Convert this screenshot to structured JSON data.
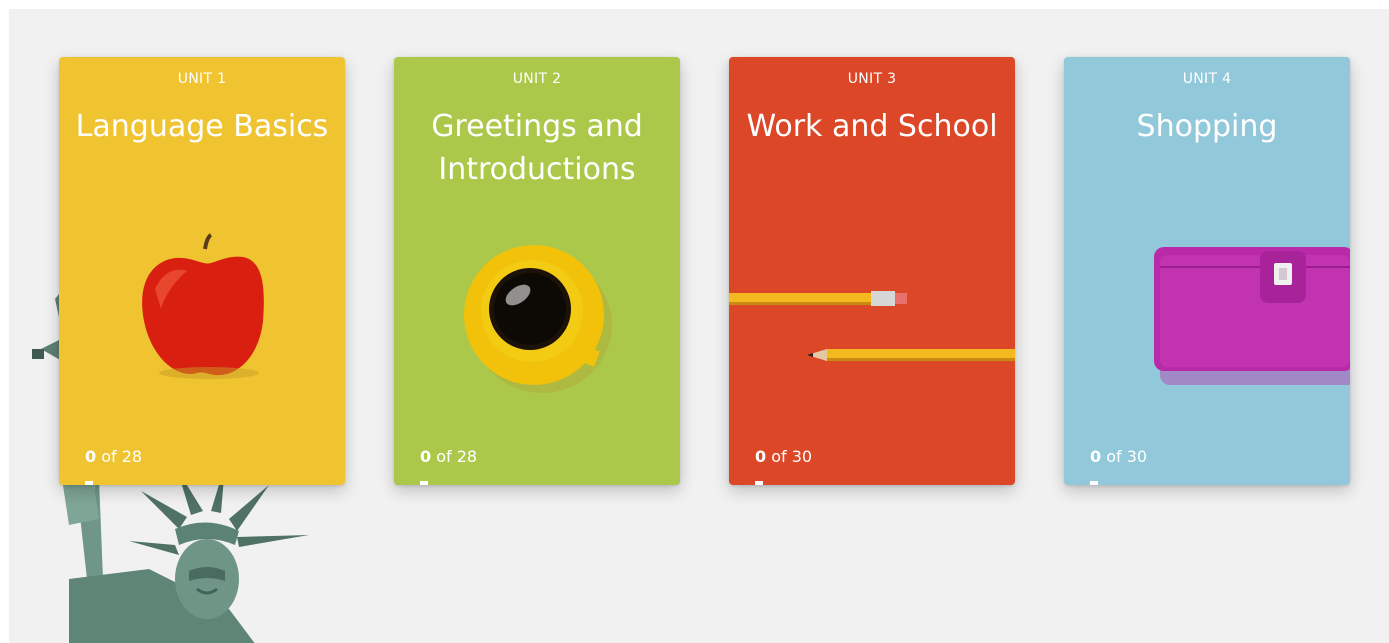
{
  "units": [
    {
      "label": "UNIT 1",
      "title": "Language Basics",
      "completed": "0",
      "of_total": "of 28",
      "progress_fraction": 0,
      "color": "#f0c431",
      "image": "apple"
    },
    {
      "label": "UNIT 2",
      "title": "Greetings and Introductions",
      "completed": "0",
      "of_total": "of 28",
      "progress_fraction": 0,
      "color": "#acc84a",
      "image": "coffee-cup"
    },
    {
      "label": "UNIT 3",
      "title": "Work and School",
      "completed": "0",
      "of_total": "of 30",
      "progress_fraction": 0,
      "color": "#dc4728",
      "image": "pencils"
    },
    {
      "label": "UNIT 4",
      "title": "Shopping",
      "completed": "0",
      "of_total": "of 30",
      "progress_fraction": 0,
      "color": "#91c8da",
      "image": "wallet"
    }
  ],
  "background_image": "statue-of-liberty"
}
